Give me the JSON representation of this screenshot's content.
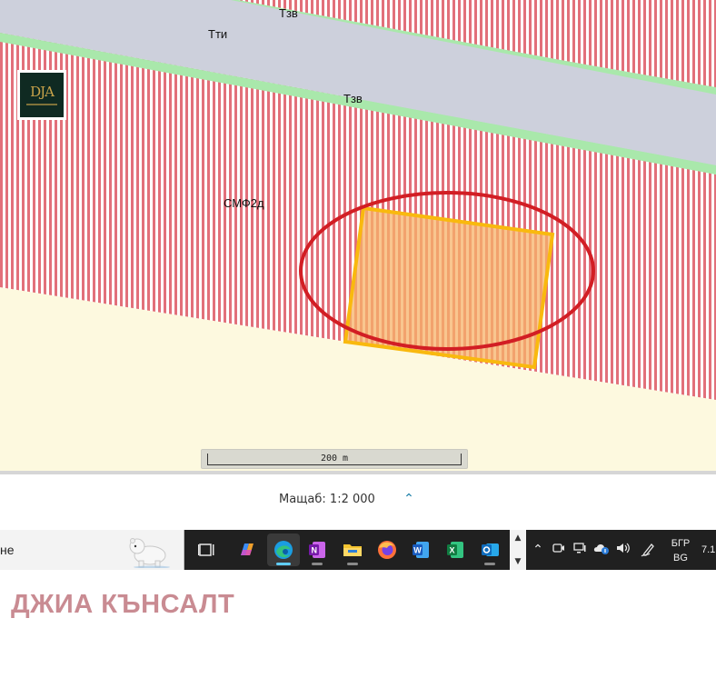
{
  "map": {
    "labels": {
      "tzv_top": "Тзв",
      "tti": "Тти",
      "tzv_mid": "Тзв",
      "smf": "СМФ2д"
    },
    "logo_text": "DJA",
    "scalebar_text": "200 m",
    "colors": {
      "road": "#cdd0dc",
      "green_strip": "#a9e8ab",
      "stripe_red": "#e2707a",
      "stripe_bg": "#ffffff",
      "yellow_zone": "#fdf9df",
      "parcel_fill": "#f7b36a",
      "parcel_border": "#f9b90e",
      "highlight_ring": "#d21e24"
    }
  },
  "scale": {
    "label": "Мащаб: 1:2 000",
    "toggle_icon": "chevron-up-icon"
  },
  "taskbar": {
    "search_text": "не",
    "apps": [
      {
        "name": "task-view-icon"
      },
      {
        "name": "copilot-icon"
      },
      {
        "name": "edge-icon"
      },
      {
        "name": "onenote-icon"
      },
      {
        "name": "file-explorer-icon"
      },
      {
        "name": "firefox-icon"
      },
      {
        "name": "word-icon"
      },
      {
        "name": "excel-icon"
      },
      {
        "name": "outlook-icon"
      }
    ],
    "lang_top": "БГР",
    "lang_bottom": "BG",
    "clock": "7.1"
  },
  "company_name": "ДЖИА КЪНСАЛТ"
}
